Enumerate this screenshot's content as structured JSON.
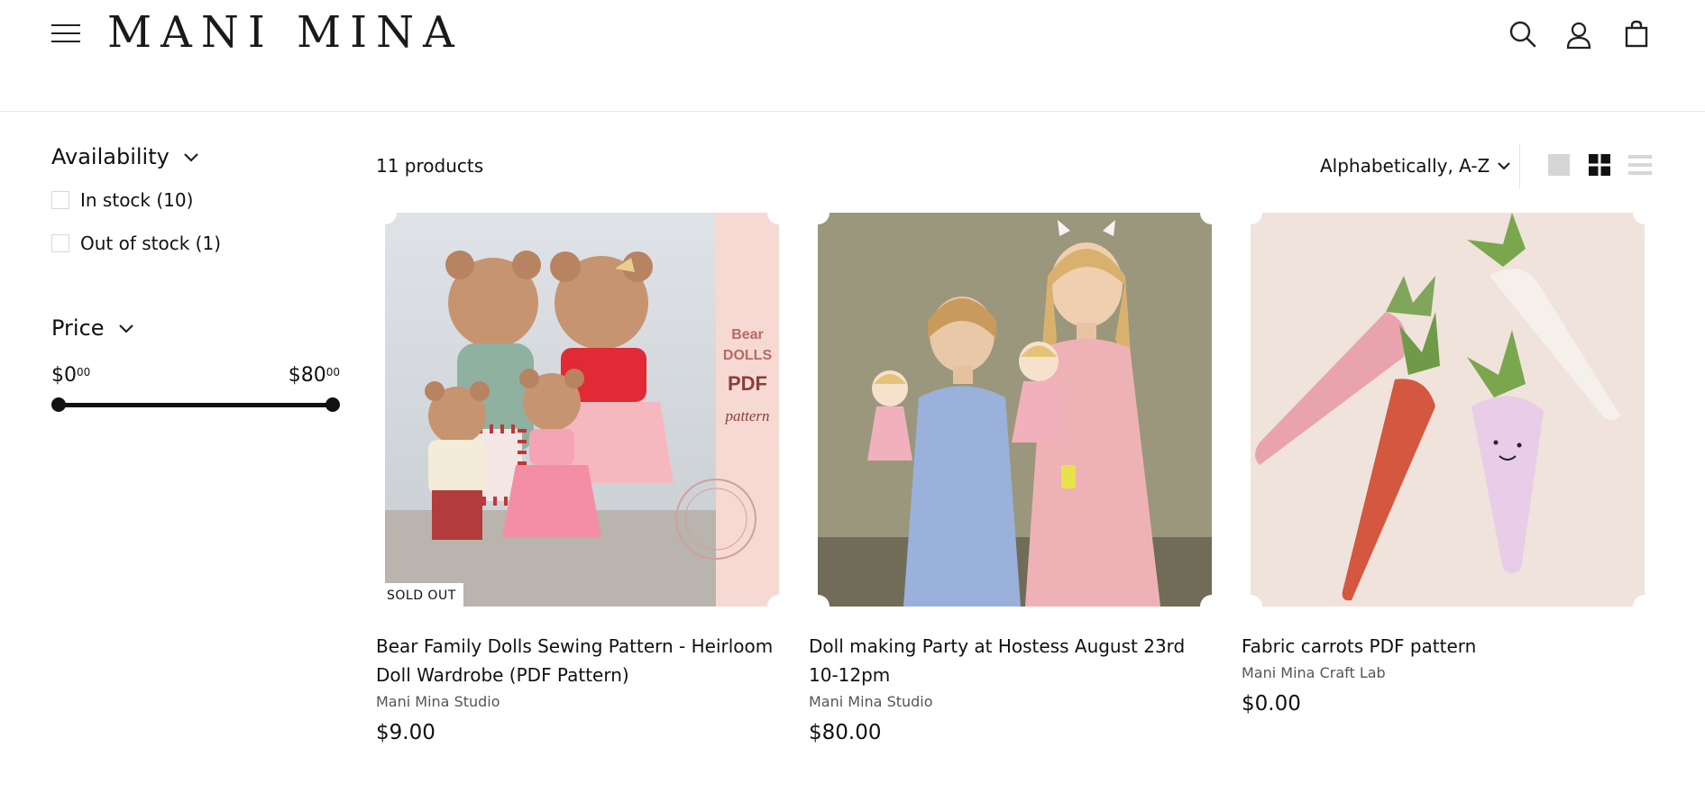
{
  "header": {
    "logo": "MANI MINA",
    "icons": [
      "menu-icon",
      "search-icon",
      "account-icon",
      "cart-icon"
    ]
  },
  "filters": {
    "availability": {
      "title": "Availability",
      "options": [
        {
          "label": "In stock (10)",
          "checked": false
        },
        {
          "label": "Out of stock (1)",
          "checked": false
        }
      ]
    },
    "price": {
      "title": "Price",
      "min_dollars": "$0",
      "min_cents": "00",
      "max_dollars": "$80",
      "max_cents": "00",
      "range_min": 0,
      "range_max": 80,
      "selected_min": 0,
      "selected_max": 80
    }
  },
  "toolbar": {
    "count": "11 products",
    "sort_label": "Alphabetically, A-Z",
    "views": [
      "view-large-icon",
      "view-grid-icon",
      "view-list-icon"
    ],
    "active_view": "view-grid-icon"
  },
  "products": [
    {
      "title": "Bear Family Dolls Sewing Pattern - Heirloom Doll Wardrobe (PDF Pattern)",
      "vendor": "Mani Mina Studio",
      "price": "$9.00",
      "badge": "SOLD OUT",
      "image_text": [
        "Bear",
        "DOLLS",
        "PDF",
        "pattern"
      ]
    },
    {
      "title": "Doll making Party at Hostess August 23rd 10-12pm",
      "vendor": "Mani Mina Studio",
      "price": "$80.00",
      "badge": ""
    },
    {
      "title": "Fabric carrots PDF pattern",
      "vendor": "Mani Mina Craft Lab",
      "price": "$0.00",
      "badge": ""
    }
  ],
  "colors": {
    "text": "#111111",
    "muted": "#555555",
    "pdf_panel": "#f6d9d3",
    "pdf_text": "#8a3f39"
  }
}
